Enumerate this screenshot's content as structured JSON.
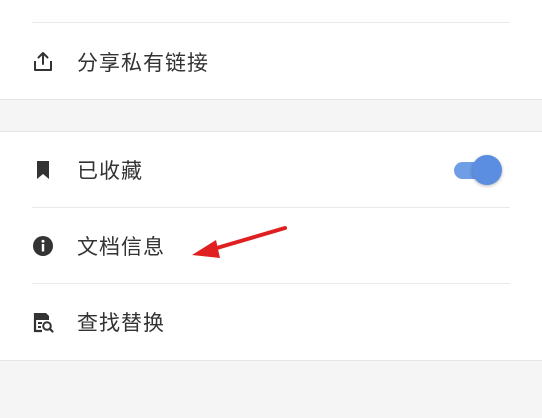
{
  "menu_group_1": {
    "items": [
      {
        "label": "分享私有链接",
        "icon": "share-upload-icon"
      }
    ]
  },
  "menu_group_2": {
    "items": [
      {
        "label": "已收藏",
        "icon": "bookmark-icon",
        "toggle_on": true
      },
      {
        "label": "文档信息",
        "icon": "info-circle-icon"
      },
      {
        "label": "查找替换",
        "icon": "find-replace-icon"
      }
    ]
  },
  "colors": {
    "toggle_accent": "#5b8de0",
    "annotation_arrow": "#e02020",
    "text": "#333333",
    "section_gap": "#f5f5f5"
  }
}
